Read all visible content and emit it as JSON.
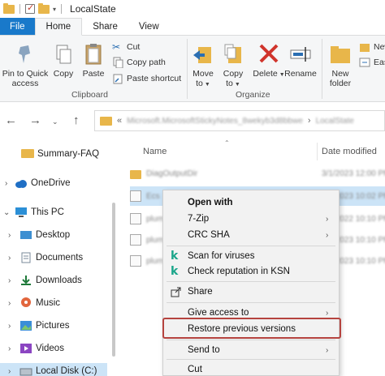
{
  "window": {
    "title": "LocalState"
  },
  "tabs": [
    {
      "label": "File"
    },
    {
      "label": "Home"
    },
    {
      "label": "Share"
    },
    {
      "label": "View"
    }
  ],
  "ribbon": {
    "clipboard": {
      "pin_line1": "Pin to Quick",
      "pin_line2": "access",
      "copy": "Copy",
      "paste": "Paste",
      "cut": "Cut",
      "copy_path": "Copy path",
      "paste_shortcut": "Paste shortcut",
      "group_label": "Clipboard"
    },
    "organize": {
      "move_to_line1": "Move",
      "move_to_line2": "to",
      "copy_to_line1": "Copy",
      "copy_to_line2": "to",
      "delete": "Delete",
      "rename": "Rename",
      "group_label": "Organize"
    },
    "new": {
      "new_folder_line1": "New",
      "new_folder_line2": "folder",
      "new_item": "New",
      "easy_access": "Eas"
    }
  },
  "address": {
    "path_hidden": "Microsoft.MicrosoftStickyNotes_8wekyb3d8bbwe",
    "current": "LocalState"
  },
  "nav_pane": {
    "items": [
      {
        "label": "Summary-FAQ"
      },
      {
        "label": "OneDrive"
      },
      {
        "label": "This PC"
      },
      {
        "label": "Desktop"
      },
      {
        "label": "Documents"
      },
      {
        "label": "Downloads"
      },
      {
        "label": "Music"
      },
      {
        "label": "Pictures"
      },
      {
        "label": "Videos"
      },
      {
        "label": "Local Disk (C:)"
      }
    ]
  },
  "file_list": {
    "col_name": "Name",
    "col_date": "Date modified",
    "rows": [
      {
        "name": "DiagOutputDir",
        "date": "3/1/2023 12:00 PM"
      },
      {
        "name": "Ecs",
        "date": "3/1/2023 10:02 PM"
      },
      {
        "name": "plum.sqlite",
        "date": "3/7/2022 10:10 PM"
      },
      {
        "name": "plum.sqlite-shm",
        "date": "3/1/2023 10:10 PM"
      },
      {
        "name": "plum.sqlite-wal",
        "date": "3/1/2023 10:10 PM"
      }
    ]
  },
  "context_menu": {
    "open_with": "Open with",
    "seven_zip": "7-Zip",
    "crc_sha": "CRC SHA",
    "scan": "Scan for viruses",
    "check_rep": "Check reputation in KSN",
    "share": "Share",
    "give_access": "Give access to",
    "restore": "Restore previous versions",
    "send_to": "Send to",
    "cut": "Cut"
  },
  "colors": {
    "accent": "#1979ca",
    "selection": "#cce4f7",
    "highlight_border": "#b5433f",
    "kaspersky": "#1aa58a"
  }
}
